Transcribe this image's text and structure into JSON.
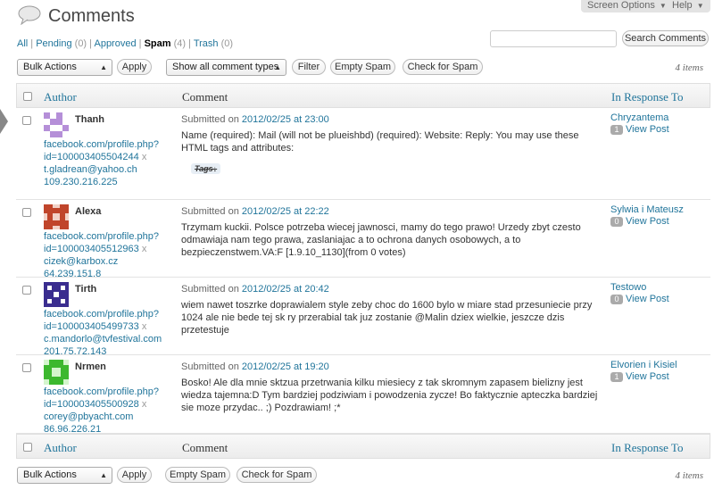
{
  "header": {
    "title": "Comments",
    "screen_options": "Screen Options",
    "help": "Help"
  },
  "filters": {
    "all": "All",
    "pending": "Pending",
    "pending_count": "(0)",
    "approved": "Approved",
    "spam": "Spam",
    "spam_count": "(4)",
    "trash": "Trash",
    "trash_count": "(0)",
    "separator": "|"
  },
  "search": {
    "value": "",
    "button": "Search Comments"
  },
  "toolbar_top": {
    "bulk_actions": "Bulk Actions",
    "apply": "Apply",
    "comment_types": "Show all comment types",
    "filter": "Filter",
    "empty_spam": "Empty Spam",
    "check_spam": "Check for Spam",
    "items": "4 items"
  },
  "table": {
    "col_author": "Author",
    "col_comment": "Comment",
    "col_response": "In Response To",
    "submitted_on": "Submitted on",
    "view_post": "View Post",
    "rows": [
      {
        "name": "Thanh",
        "url1": "facebook.com/profile.php?",
        "url2": "id=100003405504244",
        "email": "t.gladrean@yahoo.ch",
        "ip": "109.230.216.225",
        "date": "2012/02/25 at 23:00",
        "text": "Name (required): Mail (will not be plueishbd) (required): Website: Reply: You may use these HTML tags and attributes:",
        "tag": "Tags↓",
        "post": "Chryzantema",
        "count": "1",
        "avatar_color": "#b58fd8"
      },
      {
        "name": "Alexa",
        "url1": "facebook.com/profile.php?",
        "url2": "id=100003405512963",
        "email": "cizek@karbox.cz",
        "ip": "64.239.151.8",
        "date": "2012/02/25 at 22:22",
        "text": "Trzymam kuckii. Polsce potrzeba wiecej jawnosci, mamy do tego prawo! Urzedy zbyt czesto odmawiaja nam tego prawa, zaslaniajac a to ochrona danych osobowych, a to bezpieczenstwem.VA:F [1.9.10_1130](from 0 votes)",
        "post": "Sylwia i Mateusz",
        "count": "0",
        "avatar_color": "#c0452b"
      },
      {
        "name": "Tirth",
        "url1": "facebook.com/profile.php?",
        "url2": "id=100003405499733",
        "email": "c.mandorlo@tvfestival.com",
        "ip": "201.75.72.143",
        "date": "2012/02/25 at 20:42",
        "text": "wiem nawet toszrke doprawialem style zeby choc do 1600 bylo w miare stad przesuniecie przy 1024 ale nie bede tej sk ry przerabial tak juz zostanie @Malin dziex wielkie, jeszcze dzis przetestuje",
        "post": "Testowo",
        "count": "0",
        "avatar_color": "#3a2d8f"
      },
      {
        "name": "Nrmen",
        "url1": "facebook.com/profile.php?",
        "url2": "id=100003405500928",
        "email": "corey@pbyacht.com",
        "ip": "86.96.226.21",
        "date": "2012/02/25 at 19:20",
        "text": "Bosko! Ale dla mnie sktzua przetrwania kilku miesiecy z tak skromnym zapasem bielizny jest wiedza tajemna:D Tym bardziej podziwiam i powodzenia zycze! Bo faktycznie apteczka bardziej sie moze przydac.. ;) Pozdrawiam! ;*",
        "post": "Elvorien i Kisiel",
        "count": "1",
        "avatar_color": "#3cb82e"
      }
    ]
  },
  "toolbar_bottom": {
    "bulk_actions": "Bulk Actions",
    "apply": "Apply",
    "empty_spam": "Empty Spam",
    "check_spam": "Check for Spam",
    "items": "4 items"
  }
}
